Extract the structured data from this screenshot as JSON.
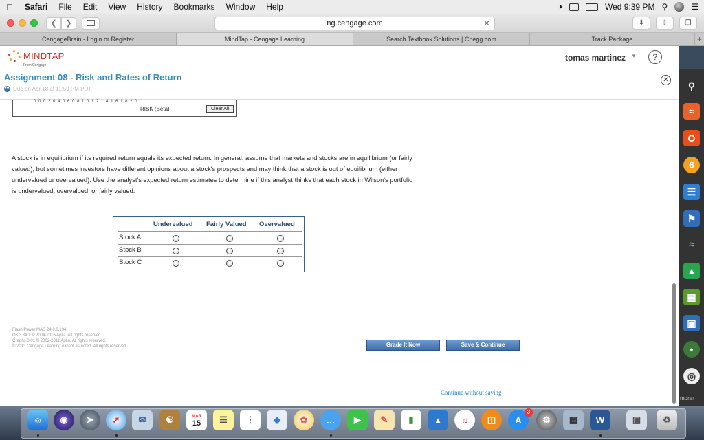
{
  "menubar": {
    "app": "Safari",
    "items": [
      "File",
      "Edit",
      "View",
      "History",
      "Bookmarks",
      "Window",
      "Help"
    ],
    "clock": "Wed 9:39 PM"
  },
  "browser": {
    "url": "ng.cengage.com",
    "tabs": [
      {
        "label": "CengageBrain - Login or Register",
        "active": false
      },
      {
        "label": "MindTap - Cengage Learning",
        "active": true
      },
      {
        "label": "Search Textbook Solutions | Chegg.com",
        "active": false
      },
      {
        "label": "Track Package",
        "active": false
      }
    ]
  },
  "header": {
    "logo": "MINDTAP",
    "logo_sub": "From Cengage",
    "user_name": "tomas martinez",
    "help_glyph": "?"
  },
  "assignment": {
    "title": "Assignment 08 - Risk and Rates of Return",
    "due": "Due on Apr 18 at 11:59 PM PDT",
    "due_glyph": "•••"
  },
  "graph": {
    "ticks": "0.0  0.2  0.4  0.6  0.8  1.0  1.2  1.4  1.6  1.8  2.0",
    "axis_label": "RISK (Beta)",
    "clear_label": "Clear All"
  },
  "question": {
    "text": "A stock is in equilibrium if its required return equals its expected return. In general, assume that markets and stocks are in equilibrium (or fairly valued), but sometimes investors have different opinions about a stock's prospects and may think that a stock is out of equilibrium (either undervalued or overvalued). Use the analyst's expected return estimates to determine if this analyst thinks that each stock in Wilson's portfolio is undervalued, overvalued, or fairly valued.",
    "columns": [
      "Undervalued",
      "Fairly Valued",
      "Overvalued"
    ],
    "rows": [
      "Stock A",
      "Stock B",
      "Stock C"
    ]
  },
  "footer": {
    "lines": [
      "Flash Player MAC 24,0,0,194",
      "Q3 3.34.1 © 2004-2016 Aplia. All rights reserved.",
      "Graphs 3.01 © 2002-2011 Aplia. All rights reserved.",
      "© 2013 Cengage Learning except as noted. All rights reserved."
    ],
    "grade_label": "Grade It Now",
    "save_label": "Save & Continue",
    "continue_label": "Continue without saving"
  },
  "sidebar": {
    "more_label": "more",
    "icons": [
      "search-icon",
      "rss-icon",
      "office-icon",
      "six-icon",
      "notes-icon",
      "bookmark-icon",
      "read-aloud-icon",
      "google-drive-icon",
      "cart-icon",
      "cards-icon",
      "merriam-webster-icon",
      "help-ring-icon"
    ]
  },
  "dock": {
    "calendar_month": "MAR",
    "calendar_day": "15",
    "appstore_badge": "3",
    "word_glyph": "W"
  }
}
